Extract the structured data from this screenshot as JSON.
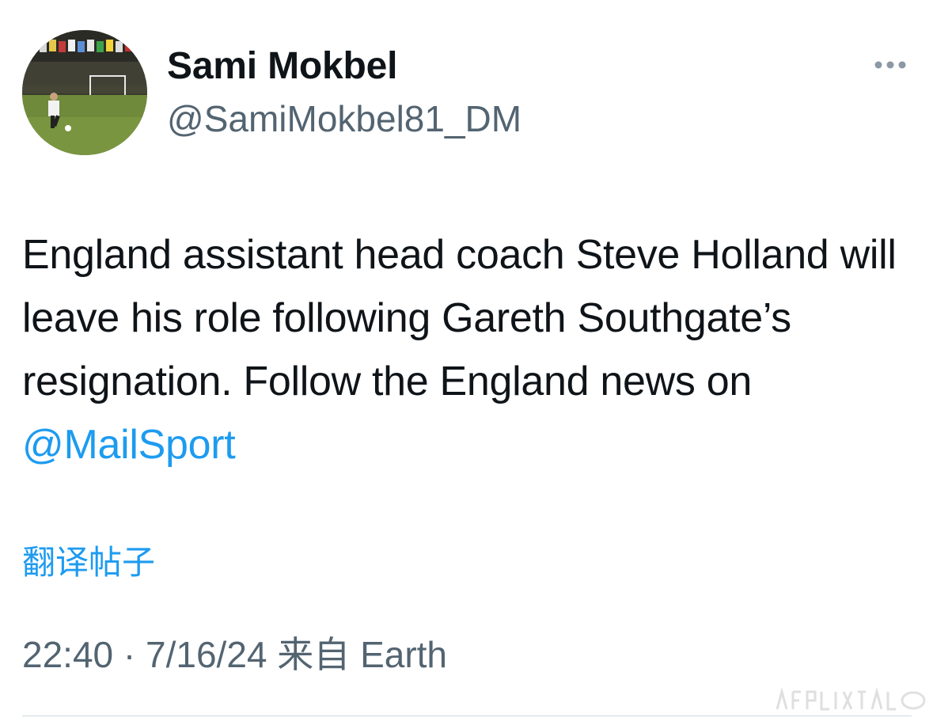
{
  "author": {
    "display_name": "Sami Mokbel",
    "handle": "@SamiMokbel81_DM",
    "avatar_icon": "profile-photo-football-pitch"
  },
  "more_icon": "more-horizontal-icon",
  "tweet": {
    "text_before": "England assistant head coach Steve Holland will leave his role following Gareth Southgate’s resignation. Follow the England news on ",
    "mention": "@MailSport"
  },
  "translate_label": "翻译帖子",
  "meta": {
    "time": "22:40",
    "separator": "·",
    "date": "7/16/24",
    "source_prefix": "来自",
    "source": "Earth"
  },
  "colors": {
    "link": "#1d9bf0",
    "secondary": "#536471",
    "primary": "#0f1419"
  }
}
